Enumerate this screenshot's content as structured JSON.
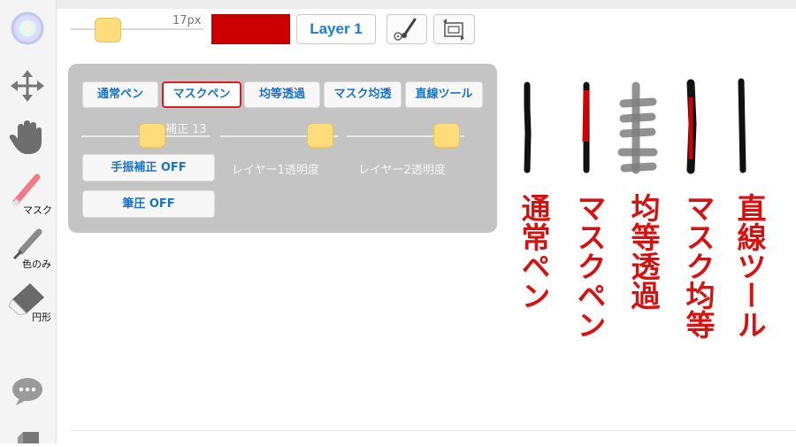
{
  "sidebar": {
    "items": [
      {
        "name": "color-wheel",
        "label": ""
      },
      {
        "name": "move",
        "label": ""
      },
      {
        "name": "hand",
        "label": ""
      },
      {
        "name": "mask-pen",
        "label": "マスク"
      },
      {
        "name": "eyedropper",
        "label": "色のみ"
      },
      {
        "name": "eraser",
        "label": "円形"
      },
      {
        "name": "chat",
        "label": ""
      }
    ]
  },
  "toolbar": {
    "brush_size_label": "17px",
    "brush_size_fraction": 0.28,
    "color": "#cc0000",
    "layer_label": "Layer 1"
  },
  "pen_panel": {
    "modes": [
      "通常ペン",
      "マスクペン",
      "均等透過",
      "マスク均透",
      "直線ツール"
    ],
    "active_mode": "マスクペン",
    "correction_label": "補正 13",
    "correction_fraction": 0.55,
    "layer1_opacity_label": "レイヤー1透明度",
    "layer1_opacity_fraction": 0.85,
    "layer2_opacity_label": "レイヤー2透明度",
    "layer2_opacity_fraction": 0.85,
    "stabilizer_button": "手振補正 OFF",
    "pressure_button": "筆圧 OFF"
  },
  "demo": {
    "labels": [
      "通常ペン",
      "マスクペン",
      "均等透過",
      "マスク均等",
      "直線ツール"
    ],
    "accent_color": "#d81010"
  }
}
